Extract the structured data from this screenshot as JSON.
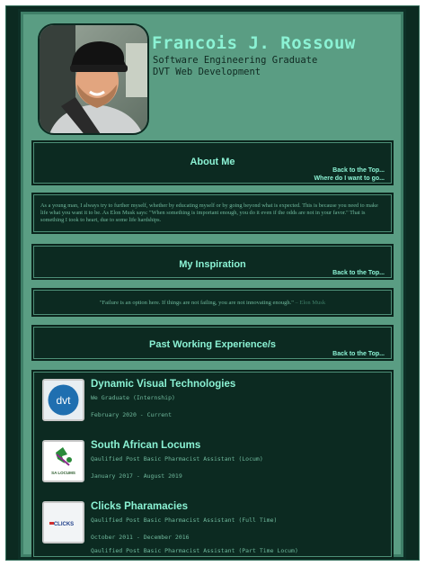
{
  "profile": {
    "name": "Francois J. Rossouw",
    "line1": "Software Engineering Graduate",
    "line2": "DVT Web Development"
  },
  "about": {
    "title": "About Me",
    "link_top": "Back to the Top...",
    "link_goal": "Where do I want to go...",
    "text": "As a young man, I always try to further myself, whether by educating myself or by going beyond what is expected. This is because you need to make life what you want it to be. As Elon Musk says: \"When something is important enough, you do it even if the odds are not in your favor.\" That is something I took to heart, due to some life hardships."
  },
  "inspiration": {
    "title": "My Inspiration",
    "link_top": "Back to the Top...",
    "quote": "\"Failure is an option here. If things are not failing, you are not innovating enough.\"",
    "author": "– Elon Musk"
  },
  "experience": {
    "title": "Past Working Experience/s",
    "link_top": "Back to the Top...",
    "jobs": [
      {
        "company": "Dynamic Visual Technologies",
        "role": "We Graduate (Internship)",
        "dates": "February 2020 - Current",
        "logo_text": "dvt"
      },
      {
        "company": "South African Locums",
        "role": "Qaulified Post Basic Pharmacist Assistant (Locum)",
        "dates": "January 2017 - August 2019",
        "logo_text": "SA LOCUMS"
      },
      {
        "company": "Clicks Pharamacies",
        "role": "Qaulified Post Basic Pharmacist Assistant (Full Time)",
        "dates": "October 2011 - December 2016",
        "role2": "Qaulified Post Basic Pharmacist Assistant (Part Time Locum)",
        "logo_text": "CLICKS"
      }
    ]
  },
  "colors": {
    "page_dark": "#0c2a21",
    "panel_green": "#5a9d83",
    "accent_mint": "#8bf2d4",
    "dvt_blue": "#1f6fb0"
  }
}
